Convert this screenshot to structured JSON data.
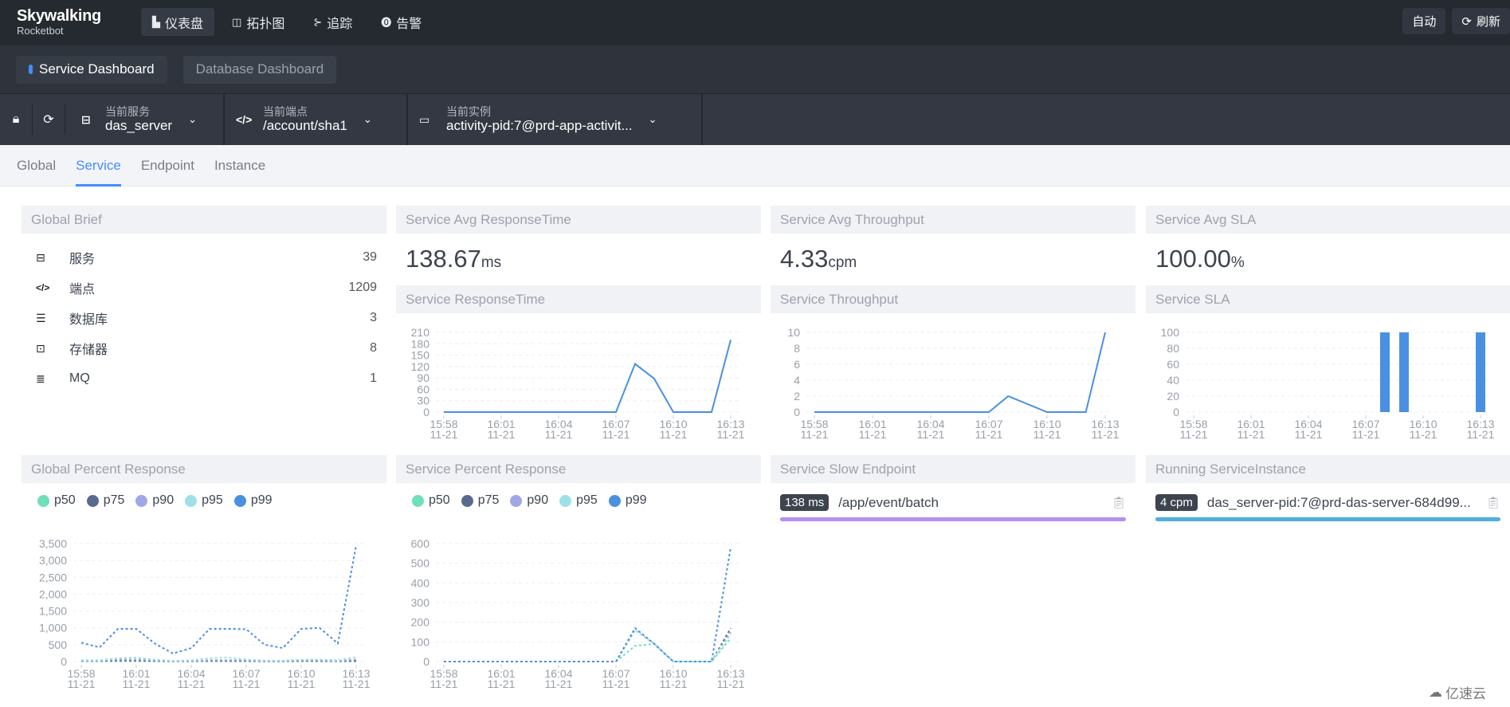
{
  "header": {
    "logo_title": "Skywalking",
    "logo_subtitle": "Rocketbot",
    "nav": [
      {
        "icon": "dashboard-icon",
        "glyph": "▙",
        "label": "仪表盘",
        "active": true
      },
      {
        "icon": "topology-icon",
        "glyph": "◫",
        "label": "拓扑图",
        "active": false
      },
      {
        "icon": "trace-icon",
        "glyph": "⊱",
        "label": "追踪",
        "active": false
      },
      {
        "icon": "alarm-icon",
        "glyph": "⓿",
        "label": "告警",
        "active": false
      }
    ],
    "auto_label": "自动",
    "refresh_label": "刷新"
  },
  "dashboards": {
    "tabs": [
      {
        "label": "Service Dashboard",
        "active": true
      },
      {
        "label": "Database Dashboard",
        "active": false
      }
    ]
  },
  "selectors": {
    "service": {
      "label": "当前服务",
      "value": "das_server"
    },
    "endpoint": {
      "label": "当前端点",
      "value": "/account/sha1"
    },
    "instance": {
      "label": "当前实例",
      "value": "activity-pid:7@prd-app-activit..."
    }
  },
  "tabs": [
    {
      "label": "Global",
      "active": false
    },
    {
      "label": "Service",
      "active": true
    },
    {
      "label": "Endpoint",
      "active": false
    },
    {
      "label": "Instance",
      "active": false
    }
  ],
  "global_brief": {
    "title": "Global Brief",
    "items": [
      {
        "icon": "service-icon",
        "label": "服务",
        "value": "39"
      },
      {
        "icon": "endpoint-icon",
        "label": "端点",
        "value": "1209"
      },
      {
        "icon": "database-icon",
        "label": "数据库",
        "value": "3"
      },
      {
        "icon": "cache-icon",
        "label": "存储器",
        "value": "8"
      },
      {
        "icon": "mq-icon",
        "label": "MQ",
        "value": "1"
      }
    ]
  },
  "avg_response": {
    "title": "Service Avg ResponseTime",
    "value": "138.67",
    "unit": "ms"
  },
  "avg_throughput": {
    "title": "Service Avg Throughput",
    "value": "4.33",
    "unit": "cpm"
  },
  "avg_sla": {
    "title": "Service Avg SLA",
    "value": "100.00",
    "unit": "%"
  },
  "global_percent_title": "Global Percent Response",
  "service_percent_title": "Service Percent Response",
  "slow_endpoint": {
    "title": "Service Slow Endpoint",
    "items": [
      {
        "badge": "138 ms",
        "name": "/app/event/batch",
        "bar_color": "#b58ef2",
        "fill": 1.0
      }
    ]
  },
  "running_instance": {
    "title": "Running ServiceInstance",
    "items": [
      {
        "badge": "4 cpm",
        "name": "das_server-pid:7@prd-das-server-684d99...",
        "bar_color": "#4eaee0",
        "fill": 1.0
      }
    ]
  },
  "legend": [
    {
      "name": "p50",
      "color": "#6fdfb8"
    },
    {
      "name": "p75",
      "color": "#5a6a8e"
    },
    {
      "name": "p90",
      "color": "#a0a7e6"
    },
    {
      "name": "p95",
      "color": "#9ee0e8"
    },
    {
      "name": "p99",
      "color": "#4a90e2"
    }
  ],
  "watermark": "亿速云",
  "chart_data": [
    {
      "id": "service-responsetime",
      "title": "Service ResponseTime",
      "type": "line",
      "x_labels": [
        "15:58\n11-21",
        "16:01\n11-21",
        "16:04\n11-21",
        "16:07\n11-21",
        "16:10\n11-21",
        "16:13\n11-21"
      ],
      "x_count": 16,
      "yticks": [
        0,
        30,
        60,
        90,
        120,
        150,
        180,
        210
      ],
      "ylim": [
        0,
        210
      ],
      "series": [
        {
          "name": "ResponseTime",
          "color": "#4a90e2",
          "dashed": false,
          "values": [
            0,
            0,
            0,
            0,
            0,
            0,
            0,
            0,
            0,
            0,
            127,
            88,
            0,
            0,
            0,
            190
          ]
        }
      ]
    },
    {
      "id": "service-throughput",
      "title": "Service Throughput",
      "type": "line",
      "x_labels": [
        "15:58\n11-21",
        "16:01\n11-21",
        "16:04\n11-21",
        "16:07\n11-21",
        "16:10\n11-21",
        "16:13\n11-21"
      ],
      "x_count": 16,
      "yticks": [
        0,
        2,
        4,
        6,
        8,
        10
      ],
      "ylim": [
        0,
        10
      ],
      "series": [
        {
          "name": "Throughput",
          "color": "#4a90e2",
          "dashed": false,
          "values": [
            0,
            0,
            0,
            0,
            0,
            0,
            0,
            0,
            0,
            0,
            2,
            1,
            0,
            0,
            0,
            10
          ]
        }
      ]
    },
    {
      "id": "service-sla",
      "title": "Service SLA",
      "type": "bar",
      "x_labels": [
        "15:58\n11-21",
        "16:01\n11-21",
        "16:04\n11-21",
        "16:07\n11-21",
        "16:10\n11-21",
        "16:13\n11-21"
      ],
      "x_count": 16,
      "yticks": [
        0,
        20,
        40,
        60,
        80,
        100
      ],
      "ylim": [
        0,
        100
      ],
      "series": [
        {
          "name": "SLA",
          "color": "#4a90e2",
          "values": [
            0,
            0,
            0,
            0,
            0,
            0,
            0,
            0,
            0,
            0,
            100,
            100,
            0,
            0,
            0,
            100
          ]
        }
      ]
    },
    {
      "id": "global-percent-response",
      "title": "Global Percent Response",
      "type": "line",
      "x_labels": [
        "15:58\n11-21",
        "16:01\n11-21",
        "16:04\n11-21",
        "16:07\n11-21",
        "16:10\n11-21",
        "16:13\n11-21"
      ],
      "x_count": 16,
      "yticks": [
        0,
        500,
        1000,
        1500,
        2000,
        2500,
        3000,
        3500
      ],
      "ytick_labels": [
        "0",
        "500",
        "1,000",
        "1,500",
        "2,000",
        "2,500",
        "3,000",
        "3,500"
      ],
      "ylim": [
        0,
        3500
      ],
      "series": [
        {
          "name": "p50",
          "color": "#6fdfb8",
          "dashed": true,
          "values": [
            10,
            10,
            10,
            10,
            10,
            10,
            10,
            10,
            10,
            10,
            10,
            10,
            10,
            10,
            10,
            10
          ]
        },
        {
          "name": "p75",
          "color": "#5a6a8e",
          "dashed": true,
          "values": [
            20,
            20,
            30,
            30,
            20,
            10,
            10,
            20,
            20,
            20,
            10,
            10,
            20,
            20,
            10,
            20
          ]
        },
        {
          "name": "p90",
          "color": "#a0a7e6",
          "dashed": true,
          "values": [
            30,
            30,
            60,
            60,
            40,
            20,
            20,
            40,
            40,
            40,
            20,
            20,
            40,
            40,
            20,
            60
          ]
        },
        {
          "name": "p95",
          "color": "#9ee0e8",
          "dashed": true,
          "values": [
            40,
            40,
            100,
            120,
            60,
            20,
            40,
            100,
            120,
            60,
            30,
            30,
            60,
            60,
            40,
            130
          ]
        },
        {
          "name": "p99",
          "color": "#4a90e2",
          "dashed": true,
          "values": [
            560,
            420,
            970,
            970,
            540,
            240,
            400,
            970,
            970,
            960,
            500,
            400,
            970,
            1000,
            540,
            3450
          ]
        }
      ]
    },
    {
      "id": "service-percent-response",
      "title": "Service Percent Response",
      "type": "line",
      "x_labels": [
        "15:58\n11-21",
        "16:01\n11-21",
        "16:04\n11-21",
        "16:07\n11-21",
        "16:10\n11-21",
        "16:13\n11-21"
      ],
      "x_count": 16,
      "yticks": [
        0,
        100,
        200,
        300,
        400,
        500,
        600
      ],
      "ylim": [
        0,
        600
      ],
      "series": [
        {
          "name": "p50",
          "color": "#6fdfb8",
          "dashed": true,
          "values": [
            0,
            0,
            0,
            0,
            0,
            0,
            0,
            0,
            0,
            0,
            80,
            90,
            0,
            0,
            0,
            120
          ]
        },
        {
          "name": "p75",
          "color": "#5a6a8e",
          "dashed": true,
          "values": [
            0,
            0,
            0,
            0,
            0,
            0,
            0,
            0,
            0,
            0,
            160,
            90,
            0,
            0,
            0,
            170
          ]
        },
        {
          "name": "p90",
          "color": "#a0a7e6",
          "dashed": true,
          "values": [
            0,
            0,
            0,
            0,
            0,
            0,
            0,
            0,
            0,
            0,
            160,
            90,
            0,
            0,
            0,
            150
          ]
        },
        {
          "name": "p95",
          "color": "#9ee0e8",
          "dashed": true,
          "values": [
            0,
            0,
            0,
            0,
            0,
            0,
            0,
            0,
            0,
            0,
            160,
            90,
            0,
            0,
            0,
            140
          ]
        },
        {
          "name": "p99",
          "color": "#4a90e2",
          "dashed": true,
          "values": [
            0,
            0,
            0,
            0,
            0,
            0,
            0,
            0,
            0,
            0,
            170,
            90,
            0,
            0,
            0,
            580
          ]
        }
      ]
    }
  ]
}
